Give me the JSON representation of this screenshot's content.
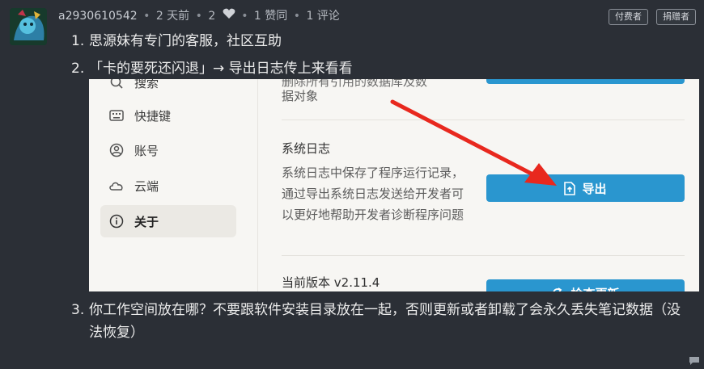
{
  "post": {
    "username": "a2930610542",
    "time": "2 天前",
    "likes": "2",
    "upvotes": "1 赞同",
    "comments": "1 评论",
    "badges": [
      "付费者",
      "捐赠者"
    ]
  },
  "content": {
    "item1": {
      "num": "1.",
      "text": "思源妹有专门的客服，社区互助"
    },
    "item2": {
      "num": "2.",
      "text": "「卡的要死还闪退」→ 导出日志传上来看看"
    },
    "item3": {
      "num": "3.",
      "text": "你工作空间放在哪？不要跟软件安装目录放在一起，否则更新或者卸载了会永久丢失笔记数据（没法恢复）"
    }
  },
  "screenshot": {
    "sidebar": [
      {
        "label": "搜索",
        "icon": "search-icon"
      },
      {
        "label": "快捷键",
        "icon": "keyboard-icon"
      },
      {
        "label": "账号",
        "icon": "account-icon"
      },
      {
        "label": "云端",
        "icon": "cloud-icon"
      },
      {
        "label": "关于",
        "icon": "info-icon",
        "active": true
      }
    ],
    "top_desc": "据对象",
    "top_desc_cut": "删除所有引用的数据库及数",
    "log_title": "系统日志",
    "log_desc": "系统日志中保存了程序运行记录，通过导出系统日志发送给开发者可以更好地帮助开发者诊断程序问题",
    "export_button": "导出",
    "version_label": "当前版本 v2.11.4",
    "update_button": "检查更新",
    "arrow_color": "#e8281e",
    "button_color": "#2a96cf"
  }
}
